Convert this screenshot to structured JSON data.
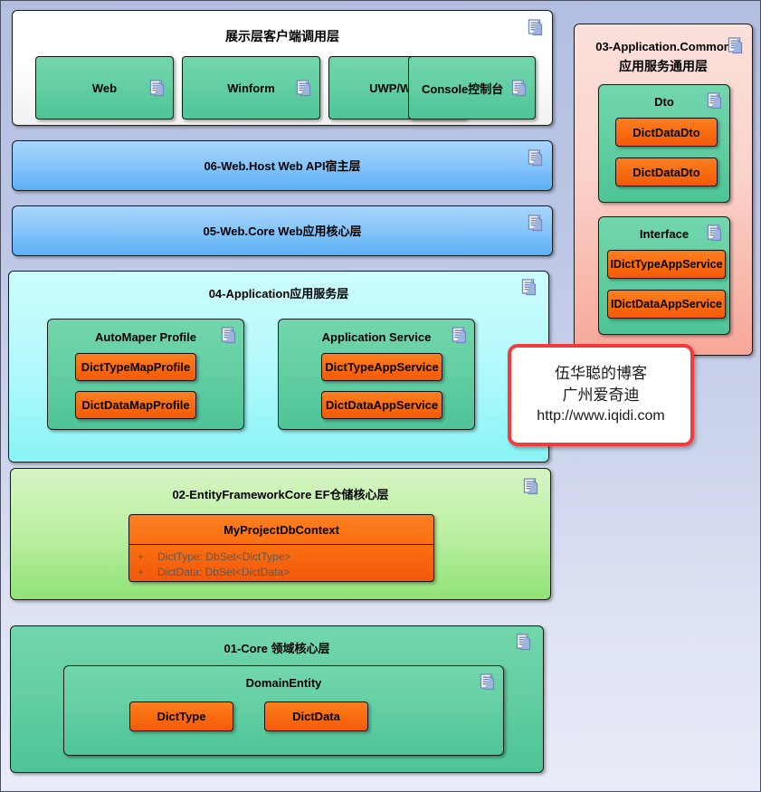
{
  "page": {
    "background_top": "#b3bfe1",
    "background_bottom": "#e9ecf8",
    "border_color": "#4a4f63"
  },
  "icons": {
    "document": "document-note-icon"
  },
  "layers": {
    "presentation": {
      "title": "展示层客户端调用层",
      "fill": "#ffffff",
      "items": [
        {
          "label": "Web"
        },
        {
          "label": "Winform"
        },
        {
          "label": "UWP/WPF"
        },
        {
          "label": "Console控制台"
        }
      ]
    },
    "web_host": {
      "title": "06-Web.Host Web API宿主层",
      "fill": "#8ec8fa"
    },
    "web_core": {
      "title": "05-Web.Core Web应用核心层",
      "fill": "#8ec8fa"
    },
    "application": {
      "title": "04-Application应用服务层",
      "fill": "#b6fafc",
      "groups": [
        {
          "title": "AutoMaper Profile",
          "fill": "#64cfa3",
          "items": [
            {
              "label": "DictTypeMapProfile"
            },
            {
              "label": "DictDataMapProfile"
            }
          ]
        },
        {
          "title": "Application Service",
          "fill": "#64cfa3",
          "items": [
            {
              "label": "DictTypeAppService"
            },
            {
              "label": "DictDataAppService"
            }
          ]
        }
      ]
    },
    "ef_core": {
      "title": "02-EntityFrameworkCore EF仓储核心层",
      "fill": "#bff0a6",
      "dbcontext": {
        "name": "MyProjectDbContext",
        "fill": "#f96f10",
        "attributes": [
          {
            "visibility": "+",
            "text": "DictType: DbSet<DictType>"
          },
          {
            "visibility": "+",
            "text": "DictData: DbSet<DictData>"
          }
        ]
      }
    },
    "core": {
      "title": "01-Core 领域核心层",
      "fill": "#64cfa3",
      "group": {
        "title": "DomainEntity",
        "items": [
          {
            "label": "DictType"
          },
          {
            "label": "DictData"
          }
        ]
      }
    },
    "application_common": {
      "title_line1": "03-Application.Common",
      "title_line2": "应用服务通用层",
      "fill": "#fad3cb",
      "groups": [
        {
          "title": "Dto",
          "fill": "#64cfa3",
          "items": [
            {
              "label": "DictDataDto"
            },
            {
              "label": "DictDataDto"
            }
          ]
        },
        {
          "title": "Interface",
          "fill": "#64cfa3",
          "items": [
            {
              "label": "IDictTypeAppService"
            },
            {
              "label": "IDictDataAppService"
            }
          ]
        }
      ]
    }
  },
  "watermark": {
    "line1": "伍华聪的博客",
    "line2": "广州爱奇迪",
    "line3": "http://www.iqidi.com",
    "border_color": "#f43b3b"
  }
}
